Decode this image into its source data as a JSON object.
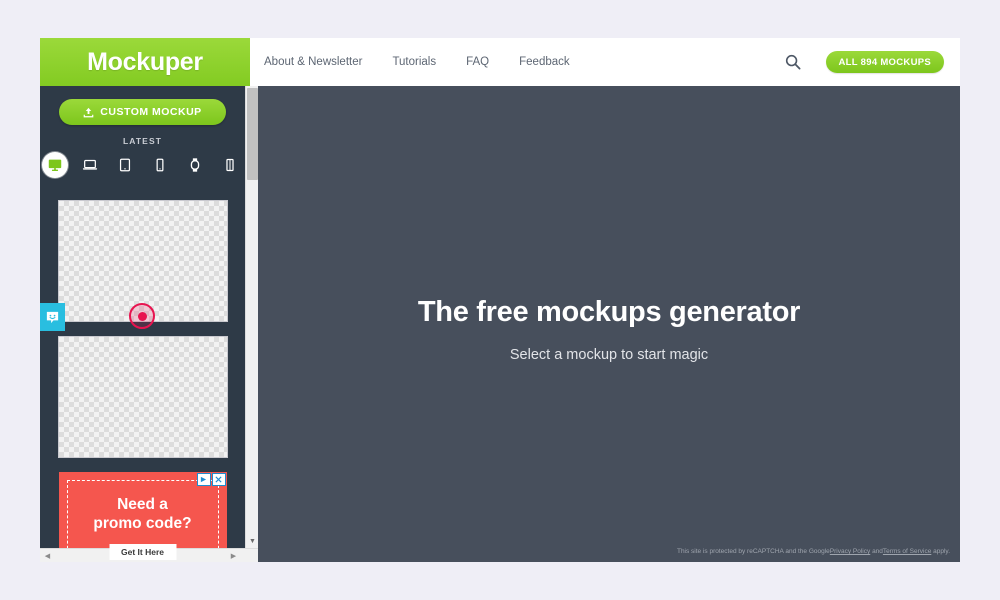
{
  "brand": {
    "name": "Mockuper",
    "green": "#8ed130",
    "dark": "#474f5c",
    "sidebar_dark": "#2e3a47"
  },
  "header": {
    "nav": [
      {
        "label": "About & Newsletter"
      },
      {
        "label": "Tutorials"
      },
      {
        "label": "FAQ"
      },
      {
        "label": "Feedback"
      }
    ],
    "search_icon": "search-icon",
    "all_mockups_label": "ALL 894 MOCKUPS"
  },
  "sidebar": {
    "custom_mockup_label": "CUSTOM MOCKUP",
    "upload_icon": "upload-icon",
    "latest_label": "LATEST",
    "devices": [
      {
        "name": "desktop-monitor",
        "active": true
      },
      {
        "name": "laptop",
        "active": false
      },
      {
        "name": "tablet",
        "active": false
      },
      {
        "name": "phone",
        "active": false
      },
      {
        "name": "watch",
        "active": false
      },
      {
        "name": "phone-vertical",
        "active": false
      }
    ],
    "thumbnails": [
      {
        "name": "mockup-thumbnail-1"
      },
      {
        "name": "mockup-thumbnail-2"
      }
    ],
    "ad": {
      "title_line1": "Need a",
      "title_line2": "promo code?",
      "cta_label": "Get It Here",
      "adchoices_icon": "adchoices-icon",
      "close_icon": "close-icon"
    },
    "feedback_tab_icon": "smiley-chat-icon"
  },
  "stage": {
    "title": "The free mockups generator",
    "subtitle": "Select a mockup to start magic",
    "recaptcha": {
      "prefix": "This site is protected by reCAPTCHA and the Google",
      "privacy_link": "Privacy Policy",
      "middle": " and",
      "terms_link": "Terms of Service",
      "suffix": " apply."
    }
  },
  "scrollbars": {
    "vertical_up": "▲",
    "vertical_down": "▼",
    "horizontal_left": "◀",
    "horizontal_right": "▶"
  }
}
